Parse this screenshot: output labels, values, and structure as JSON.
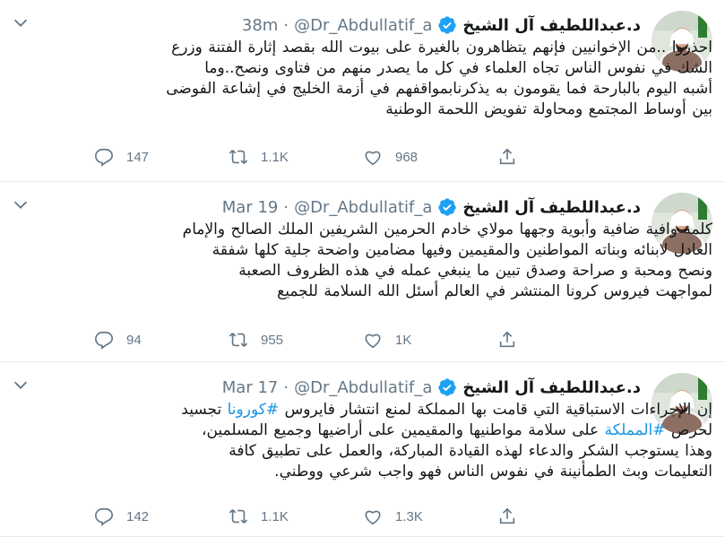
{
  "tweets": [
    {
      "name": "د.عبداللطيف آل الشيخ",
      "handle": "@Dr_Abdullatif_a",
      "separator": "·",
      "time": "38m",
      "lines": [
        "احذروا ..من الإخوانيين فإنهم يتظاهرون بالغيرة على بيوت الله بقصد إثارة الفتنة وزرع",
        "الشك في نفوس الناس تجاه العلماء في كل ما يصدر منهم من فتاوى ونصح..وما",
        "أشبه اليوم بالبارحة فما يقومون به يذكرنابمواقفهم في أزمة الخليج في إشاعة الفوضى",
        "بين أوساط المجتمع ومحاولة تفويض اللحمة الوطنية"
      ],
      "replies": "147",
      "retweets": "1.1K",
      "likes": "968"
    },
    {
      "name": "د.عبداللطيف آل الشيخ",
      "handle": "@Dr_Abdullatif_a",
      "separator": "·",
      "time": "Mar 19",
      "lines": [
        "كلمة وافية ضافية وأبوية وجهها مولاي خادم الحرمين الشريفين الملك الصالح والإمام",
        "العادل لابنائه وبناته المواطنين والمقيمين وفيها مضامين واضحة جلية كلها شفقة",
        "ونصح ومحبة و صراحة وصدق تبين ما ينبغي عمله في هذه الظروف الصعبة",
        "لمواجهت فيروس كرونا المنتشر في العالم أسئل الله السلامة للجميع"
      ],
      "replies": "94",
      "retweets": "955",
      "likes": "1K"
    },
    {
      "name": "د.عبداللطيف آل الشيخ",
      "handle": "@Dr_Abdullatif_a",
      "separator": "·",
      "time": "Mar 17",
      "line1_pre": "إن الإجراءات الاستباقية التي قامت بها المملكة لمنع انتشار فايروس",
      "line1_tag": "#كورونا",
      "line1_post": "تجسيد",
      "line2_pre": "لحرص",
      "line2_tag": "#المملكة",
      "line2_post": "على سلامة مواطنيها والمقيمين على أراضيها وجميع المسلمين،",
      "line3": "وهذا يستوجب الشكر والدعاء لهذه القيادة المباركة، والعمل على تطبيق كافة",
      "line4": "التعليمات وبث الطمأنينة في نفوس الناس فهو واجب شرعي ووطني.",
      "replies": "142",
      "retweets": "1.1K",
      "likes": "1.3K"
    }
  ],
  "colors": {
    "accent": "#1da1f2",
    "hashtag": "#1b95e0",
    "muted": "#657786",
    "divider": "#e6ecf0"
  },
  "icons": [
    "avatar",
    "verified-badge-icon",
    "chevron-down-icon",
    "reply-icon",
    "retweet-icon",
    "like-icon",
    "share-icon"
  ]
}
